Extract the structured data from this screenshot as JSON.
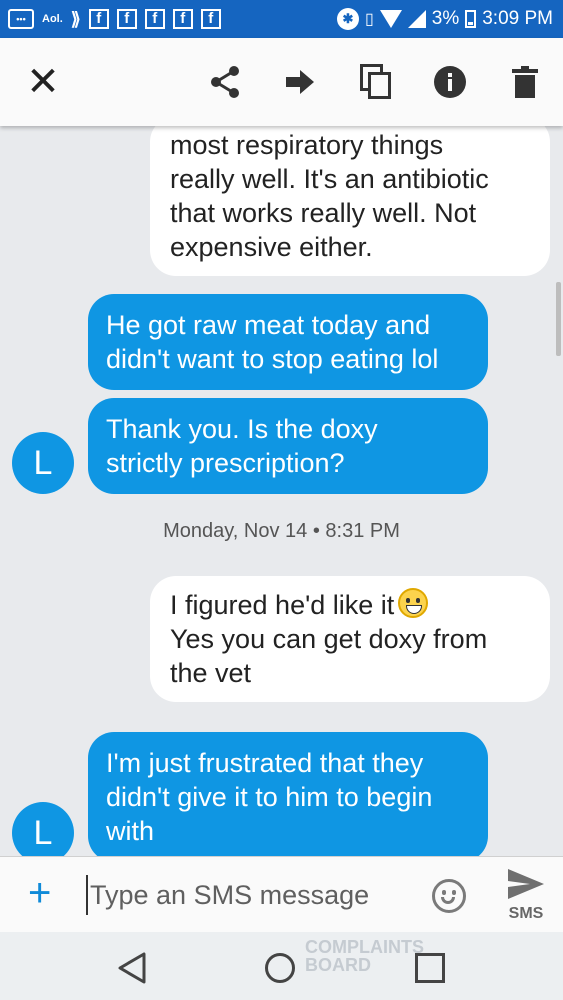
{
  "status_bar": {
    "aol_label": "Aol.",
    "battery_percent": "3%",
    "time": "3:09 PM",
    "icons": [
      "messages-icon",
      "aol-icon",
      "sprint-icon",
      "facebook-icon",
      "facebook-icon",
      "facebook-icon",
      "facebook-icon",
      "facebook-icon",
      "bluetooth-icon",
      "vibrate-icon",
      "wifi-icon",
      "signal-icon",
      "battery-icon"
    ]
  },
  "toolbar": {
    "icons": [
      "close-icon",
      "share-icon",
      "forward-icon",
      "copy-icon",
      "info-icon",
      "delete-icon"
    ]
  },
  "conversation": {
    "contact_initial": "L",
    "date_separator": "Monday, Nov 14 • 8:31 PM",
    "messages": [
      {
        "dir": "in",
        "lines": [
          "most respiratory things",
          "really well. It's an antibiotic",
          "that works really well. Not",
          "expensive either."
        ]
      },
      {
        "dir": "out",
        "lines": [
          "He got raw meat today and",
          "didn't want to stop eating lol"
        ]
      },
      {
        "dir": "out",
        "lines": [
          "Thank you.  Is the doxy",
          "strictly prescription?"
        ]
      },
      {
        "dir": "in",
        "lines": [
          "I figured he'd like it",
          "Yes you can get doxy from",
          "the vet"
        ]
      },
      {
        "dir": "out",
        "lines": [
          "I'm just frustrated that they",
          "didn't give it to him to begin",
          "with"
        ]
      }
    ]
  },
  "compose": {
    "placeholder": "Type an SMS message",
    "send_label": "SMS"
  },
  "watermark": {
    "line1": "COMPLAINTS",
    "line2": "BOARD"
  },
  "colors": {
    "status_bar": "#1565c0",
    "outgoing_bubble": "#0f96e3",
    "incoming_bubble": "#ffffff",
    "background": "#e8eaed"
  }
}
